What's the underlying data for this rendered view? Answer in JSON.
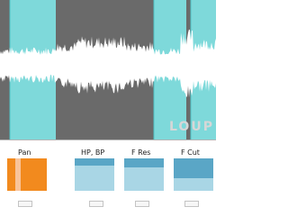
{
  "watermark": "LOUP",
  "colors": {
    "waveform_region": "#6a6a6a",
    "waveform_band": "#7ed9da",
    "waveform_wave": "#ffffff",
    "band_edge": "#4ec3c6",
    "pan_fill": "#f28a1e",
    "pan_highlight": "#f9c49a",
    "blue_dark": "#5aa6c6",
    "blue_light": "#a9d6e5"
  },
  "waveform": {
    "highlighted_regions": [
      "left-region",
      "center-right-region",
      "right-edge-region"
    ]
  },
  "controls": [
    {
      "id": "pan",
      "label": "Pan",
      "level": 1.0
    },
    {
      "id": "hp-bp",
      "label": "HP, BP",
      "level": 0.22
    },
    {
      "id": "f-res",
      "label": "F Res",
      "level": 0.28
    },
    {
      "id": "f-cut",
      "label": "F Cut",
      "level": 0.61
    }
  ]
}
